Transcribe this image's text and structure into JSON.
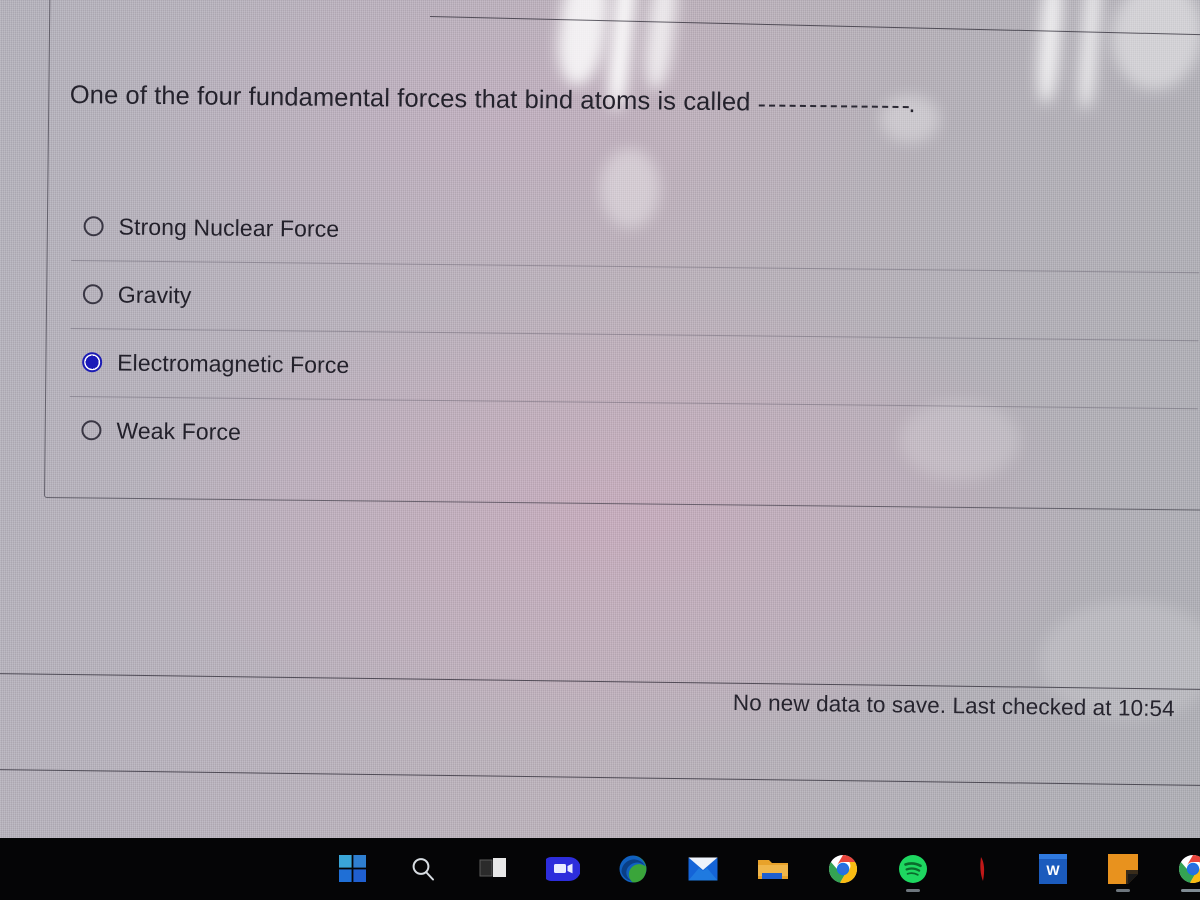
{
  "quiz": {
    "question": "One of the four fundamental forces that bind atoms is called",
    "question_suffix": ".",
    "blank_placeholder": "__________",
    "options": [
      {
        "label": "Strong Nuclear Force",
        "selected": false
      },
      {
        "label": "Gravity",
        "selected": false
      },
      {
        "label": "Electromagnetic Force",
        "selected": true
      },
      {
        "label": "Weak Force",
        "selected": false
      }
    ],
    "selected_option": "Electromagnetic Force",
    "selected_radio_color": "#1a1ab8",
    "text_color": "#23212b"
  },
  "status": {
    "save_message": "No new data to save. Last checked at 10:54"
  },
  "taskbar": {
    "background_color": "#050506",
    "items": [
      {
        "name": "start",
        "label": "Start",
        "icon": "windows-logo-icon",
        "running": false
      },
      {
        "name": "search",
        "label": "Search",
        "icon": "search-icon",
        "running": false
      },
      {
        "name": "task-view",
        "label": "Task View",
        "icon": "task-view-icon",
        "running": false
      },
      {
        "name": "zoom",
        "label": "Zoom",
        "icon": "video-camera-icon",
        "running": false
      },
      {
        "name": "edge",
        "label": "Microsoft Edge",
        "icon": "edge-icon",
        "running": false
      },
      {
        "name": "mail",
        "label": "Mail",
        "icon": "envelope-icon",
        "running": false
      },
      {
        "name": "file-explorer",
        "label": "File Explorer",
        "icon": "folder-icon",
        "running": false
      },
      {
        "name": "chrome",
        "label": "Google Chrome",
        "icon": "chrome-icon",
        "running": false
      },
      {
        "name": "spotify",
        "label": "Spotify",
        "icon": "spotify-icon",
        "running": true
      },
      {
        "name": "unknown-red",
        "label": "",
        "icon": "red-app-icon",
        "running": false
      },
      {
        "name": "word",
        "label": "W",
        "icon": "word-icon",
        "running": false
      },
      {
        "name": "sticky-notes",
        "label": "",
        "icon": "sticky-note-icon",
        "running": true
      },
      {
        "name": "chrome-window",
        "label": "Google Chrome",
        "icon": "chrome-icon",
        "running": true
      }
    ]
  }
}
